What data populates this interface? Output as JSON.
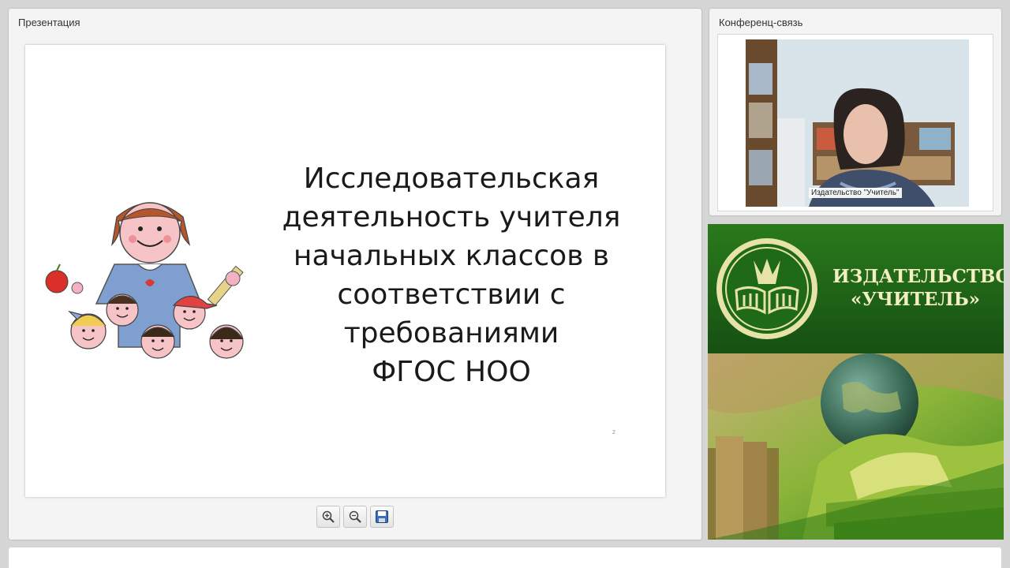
{
  "presentation": {
    "panel_title": "Презентация",
    "slide": {
      "title": "Исследовательская\nдеятельность учителя\nначальных классов в\nсоответствии с\nтребованиями\nФГОС НОО",
      "page_number": "2"
    },
    "toolbar": [
      {
        "name": "zoom-in-button",
        "icon": "zoom-in-icon"
      },
      {
        "name": "zoom-out-button",
        "icon": "zoom-out-icon"
      },
      {
        "name": "save-button",
        "icon": "floppy-disk-icon"
      }
    ]
  },
  "conference": {
    "panel_title": "Конференц-связь",
    "participant_label": "Издательство \"Учитель\""
  },
  "banner": {
    "line1": "ИЗДАТЕЛЬСТВО",
    "line2": "«УЧИТЕЛЬ»"
  },
  "colors": {
    "banner_green": "#1f6a17",
    "banner_text": "#f3eec3",
    "logo_ring": "#e6e2a8"
  }
}
